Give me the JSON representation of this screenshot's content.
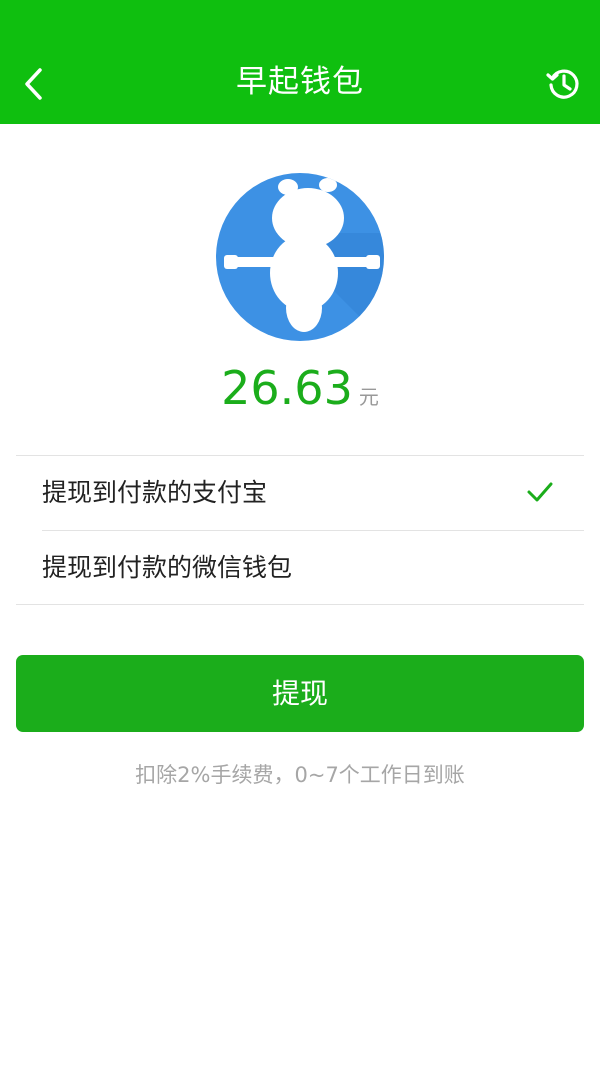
{
  "header": {
    "title": "早起钱包",
    "back_icon": "chevron-left-icon",
    "history_icon": "history-icon",
    "color": "#0fbf0f"
  },
  "balance": {
    "amount": "26.63",
    "unit": "元",
    "color": "#1bad1b"
  },
  "withdraw_options": [
    {
      "label": "提现到付款的支付宝",
      "selected": true,
      "icon": "check-icon"
    },
    {
      "label": "提现到付款的微信钱包",
      "selected": false
    }
  ],
  "withdraw_button": {
    "label": "提现",
    "color": "#1bad1b"
  },
  "note": "扣除2%手续费，0~7个工作日到账"
}
